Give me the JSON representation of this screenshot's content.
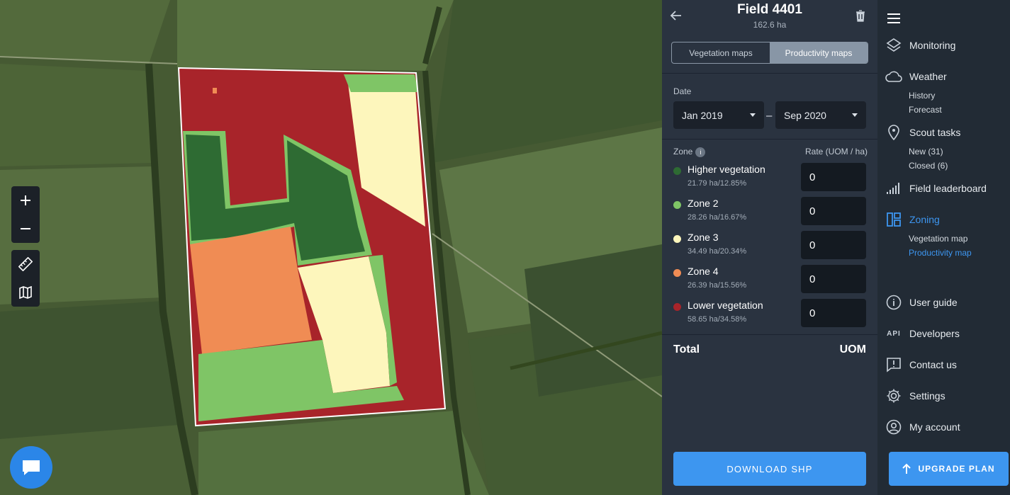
{
  "field": {
    "title": "Field 4401",
    "area": "162.6 ha"
  },
  "tabs": [
    {
      "label": "Vegetation maps"
    },
    {
      "label": "Productivity maps"
    }
  ],
  "date": {
    "label": "Date",
    "from": "Jan 2019",
    "to": "Sep 2020",
    "dash": "–"
  },
  "zones_header": {
    "zone_label": "Zone",
    "rate_label": "Rate (UOM / ha)"
  },
  "zones": [
    {
      "name": "Higher vegetation",
      "stat": "21.79 ha/12.85%",
      "rate": "0",
      "color": "#2e6b33"
    },
    {
      "name": "Zone 2",
      "stat": "28.26 ha/16.67%",
      "rate": "0",
      "color": "#7fc566"
    },
    {
      "name": "Zone 3",
      "stat": "34.49 ha/20.34%",
      "rate": "0",
      "color": "#fdf6bc"
    },
    {
      "name": "Zone 4",
      "stat": "26.39 ha/15.56%",
      "rate": "0",
      "color": "#f08c54"
    },
    {
      "name": "Lower vegetation",
      "stat": "58.65 ha/34.58%",
      "rate": "0",
      "color": "#a8242a"
    }
  ],
  "total": {
    "label": "Total",
    "unit": "UOM"
  },
  "download_label": "DOWNLOAD SHP",
  "nav": {
    "monitoring": "Monitoring",
    "weather": "Weather",
    "weather_subs": [
      "History",
      "Forecast"
    ],
    "scout": "Scout tasks",
    "scout_subs": [
      "New (31)",
      "Closed (6)"
    ],
    "leaderboard": "Field leaderboard",
    "zoning": "Zoning",
    "zoning_subs": [
      "Vegetation map",
      "Productivity map"
    ],
    "user_guide": "User guide",
    "developers": "Developers",
    "api_icon_text": "API",
    "contact": "Contact us",
    "settings": "Settings",
    "account": "My account",
    "upgrade": "UPGRADE PLAN"
  },
  "colors": {
    "accent": "#3d96f0",
    "panel_bg": "#2a3340",
    "nav_bg": "#222b35"
  }
}
